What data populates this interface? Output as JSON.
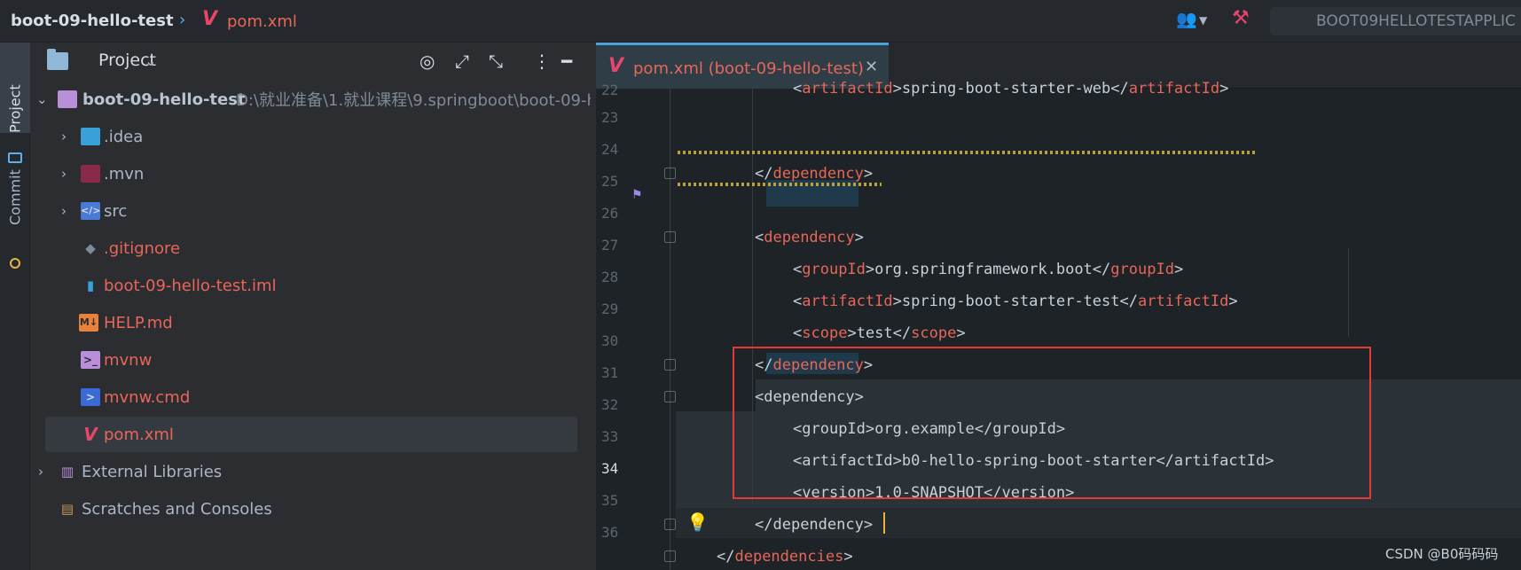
{
  "titlebar": {
    "project_name": "boot-09-hello-test",
    "current_file": "pom.xml",
    "run_config": "BOOT09HELLOTESTAPPLIC"
  },
  "toolstrip": {
    "project_tab": "Project",
    "commit_tab": "Commit"
  },
  "project_panel": {
    "title": "Project",
    "tree": [
      {
        "label": "boot-09-hello-test",
        "path": "D:\\就业准备\\1.就业课程\\9.springboot\\boot-09-h",
        "color": "#b8c4ce",
        "icon": "module-icon"
      },
      {
        "label": ".idea",
        "color": "#a9b7c6",
        "icon": "idea-folder-icon"
      },
      {
        "label": ".mvn",
        "color": "#a9b7c6",
        "icon": "mvn-folder-icon"
      },
      {
        "label": "src",
        "color": "#a9b7c6",
        "icon": "src-folder-icon"
      },
      {
        "label": ".gitignore",
        "color": "#e8665a",
        "icon": "gitignore-icon"
      },
      {
        "label": "boot-09-hello-test.iml",
        "color": "#e8665a",
        "icon": "iml-icon"
      },
      {
        "label": "HELP.md",
        "color": "#e8665a",
        "icon": "markdown-icon"
      },
      {
        "label": "mvnw",
        "color": "#e8665a",
        "icon": "shell-icon"
      },
      {
        "label": "mvnw.cmd",
        "color": "#e8665a",
        "icon": "cmd-icon"
      },
      {
        "label": "pom.xml",
        "color": "#e8665a",
        "icon": "maven-icon"
      },
      {
        "label": "External Libraries",
        "color": "#a9b7c6",
        "icon": "library-icon"
      },
      {
        "label": "Scratches and Consoles",
        "color": "#a9b7c6",
        "icon": "scratches-icon"
      }
    ]
  },
  "editor": {
    "tab_label": "pom.xml (boot-09-hello-test)",
    "line_numbers": [
      "22",
      "23",
      "24",
      "25",
      "26",
      "27",
      "28",
      "29",
      "30",
      "31",
      "32",
      "33",
      "34",
      "35",
      "36"
    ],
    "current_line": "34",
    "lines": {
      "l22": {
        "open": "artifactId",
        "text": "spring-boot-starter-web",
        "close": "artifactId"
      },
      "l23": {
        "close": "dependency"
      },
      "l25": {
        "open": "dependency"
      },
      "l26": {
        "open": "groupId",
        "text": "org.springframework.boot",
        "close": "groupId"
      },
      "l27": {
        "open": "artifactId",
        "text": "spring-boot-starter-test",
        "close": "artifactId"
      },
      "l28": {
        "open": "scope",
        "text": "test",
        "close": "scope"
      },
      "l29": {
        "close": "dependency"
      },
      "l30": {
        "open": "dependency"
      },
      "l31": {
        "open": "groupId",
        "text": "org.example",
        "close": "groupId"
      },
      "l32": {
        "open": "artifactId",
        "text": "b0-hello-spring-boot-starter",
        "close": "artifactId"
      },
      "l33": {
        "open": "version",
        "text": "1.0-SNAPSHOT",
        "close": "version"
      },
      "l34": {
        "close": "dependency"
      },
      "l35": {
        "close": "dependencies"
      }
    }
  },
  "watermark": "CSDN @B0码码码"
}
